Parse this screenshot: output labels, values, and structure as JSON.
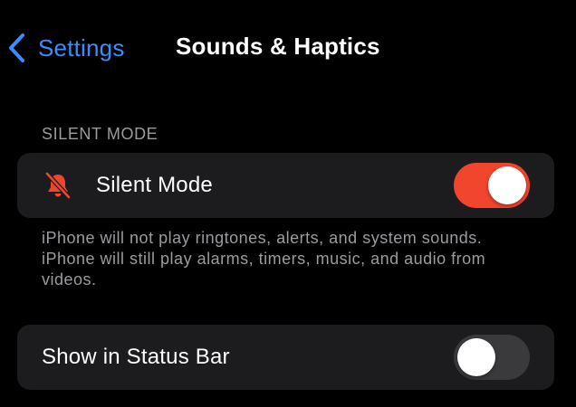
{
  "nav": {
    "back_label": "Settings",
    "title": "Sounds & Haptics"
  },
  "silent_section": {
    "header": "SILENT MODE",
    "row": {
      "icon": "bell-slash-icon",
      "label": "Silent Mode",
      "toggle_on": true
    },
    "footer": "iPhone will not play ringtones, alerts, and system sounds. iPhone will still play alarms, timers, music, and audio from videos."
  },
  "status_section": {
    "row": {
      "label": "Show in Status Bar",
      "toggle_on": false
    }
  },
  "colors": {
    "accent_blue": "#3a8cff",
    "toggle_on": "#f2452e",
    "toggle_off": "#3a3a3c",
    "group_bg": "#1c1c1e",
    "secondary_text": "#9a9a9f",
    "background": "#000000"
  }
}
